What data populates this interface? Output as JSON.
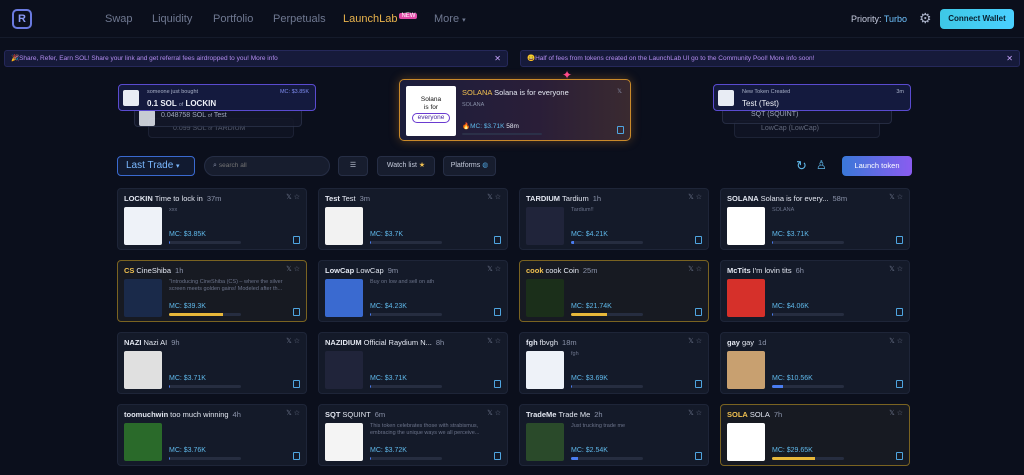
{
  "nav": {
    "items": [
      "Swap",
      "Liquidity",
      "Portfolio",
      "Perpetuals",
      "LaunchLab",
      "More"
    ],
    "new_badge": "NEW",
    "priority_label": "Priority:",
    "priority_value": "Turbo",
    "connect": "Connect Wallet"
  },
  "banners": {
    "left": "🎉Share, Refer, Earn SOL! Share your link and get referral fees airdropped to you! More info",
    "right": "😀Half of fees from tokens created on the LaunchLab UI go to the Community Pool! More info soon!"
  },
  "ticker_left": {
    "top_caption": "someone just bought",
    "top_mc": "MC: $3.85K",
    "top_amount": "0.1 SOL",
    "top_of": "of",
    "top_token": "LOCKIN",
    "row2_amount": "0.048758 SOL",
    "row2_of": "of",
    "row2_token": "Test",
    "row3_amount": "0.099 SOL",
    "row3_of": "of",
    "row3_token": "TARDIUM"
  },
  "featured": {
    "img_text_1": "Solana",
    "img_text_2": "is for",
    "img_text_3": "everyone",
    "title_sym": "SOLANA",
    "title_name": "Solana is for everyone",
    "sub": "SOLANA",
    "mc": "MC: $3.71K",
    "age": "58m"
  },
  "ticker_right": {
    "top_caption": "New Token Created",
    "top_time": "3m",
    "top_name": "Test (Test)",
    "row2": "SQT (SQUINT)",
    "row3": "LowCap (LowCap)"
  },
  "toolbar": {
    "sort": "Last Trade",
    "search_placeholder": "search all",
    "watchlist": "Watch list",
    "platforms": "Platforms",
    "launch": "Launch token"
  },
  "tokens": [
    {
      "sym": "LOCKIN",
      "name": "Time to lock in",
      "time": "37m",
      "desc": "xxx",
      "mc": "MC: $3.85K",
      "progress": 0.0
    },
    {
      "sym": "Test",
      "name": "Test",
      "time": "3m",
      "desc": "",
      "mc": "MC: $3.7K",
      "progress": 0.0
    },
    {
      "sym": "TARDIUM",
      "name": "Tardium",
      "time": "1h",
      "desc": "Tardium!!",
      "mc": "MC: $4.21K",
      "progress": 0.04
    },
    {
      "sym": "SOLANA",
      "name": "Solana is for every...",
      "time": "58m",
      "desc": "SOLANA",
      "mc": "MC: $3.71K",
      "progress": 0.0
    },
    {
      "sym": "CS",
      "name": "CineShiba",
      "time": "1h",
      "desc": "\"Introducing CineShiba (CS) – where the silver screen meets golden gains! Modeled after th...",
      "mc": "MC: $39.3K",
      "progress": 0.75
    },
    {
      "sym": "LowCap",
      "name": "LowCap",
      "time": "9m",
      "desc": "Buy on low and sell on ath",
      "mc": "MC: $4.23K",
      "progress": 0.0
    },
    {
      "sym": "cook",
      "name": "cook Coin",
      "time": "25m",
      "desc": "",
      "mc": "MC: $21.74K",
      "progress": 0.5
    },
    {
      "sym": "McTits",
      "name": "I'm lovin tits",
      "time": "6h",
      "desc": "",
      "mc": "MC: $4.06K",
      "progress": 0.0
    },
    {
      "sym": "NAZI",
      "name": "Nazi AI",
      "time": "9h",
      "desc": "",
      "mc": "MC: $3.71K",
      "progress": 0.0
    },
    {
      "sym": "NAZIDIUM",
      "name": "Official Raydium N...",
      "time": "8h",
      "desc": "",
      "mc": "MC: $3.71K",
      "progress": 0.0
    },
    {
      "sym": "fgh",
      "name": "fbvgh",
      "time": "18m",
      "desc": "fgh",
      "mc": "MC: $3.69K",
      "progress": 0.0
    },
    {
      "sym": "gay",
      "name": "gay",
      "time": "1d",
      "desc": "",
      "mc": "MC: $10.56K",
      "progress": 0.15
    },
    {
      "sym": "toomuchwin",
      "name": "too much winning",
      "time": "4h",
      "desc": "",
      "mc": "MC: $3.76K",
      "progress": 0.0
    },
    {
      "sym": "SQT",
      "name": "SQUINT",
      "time": "6m",
      "desc": "This token celebrates those with strabismus, embracing the unique ways we all perceive...",
      "mc": "MC: $3.72K",
      "progress": 0.0
    },
    {
      "sym": "TradeMe",
      "name": "Trade Me",
      "time": "2h",
      "desc": "Just trucking trade me",
      "mc": "MC: $2.54K",
      "progress": 0.1
    },
    {
      "sym": "SOLA",
      "name": "SOLA",
      "time": "7h",
      "desc": "",
      "mc": "MC: $29.65K",
      "progress": 0.6
    }
  ],
  "colors": {
    "accent": "#3ec8e6",
    "gold": "#e8b83a",
    "active_nav": "#e9b34c",
    "bg": "#0b0f1c"
  }
}
